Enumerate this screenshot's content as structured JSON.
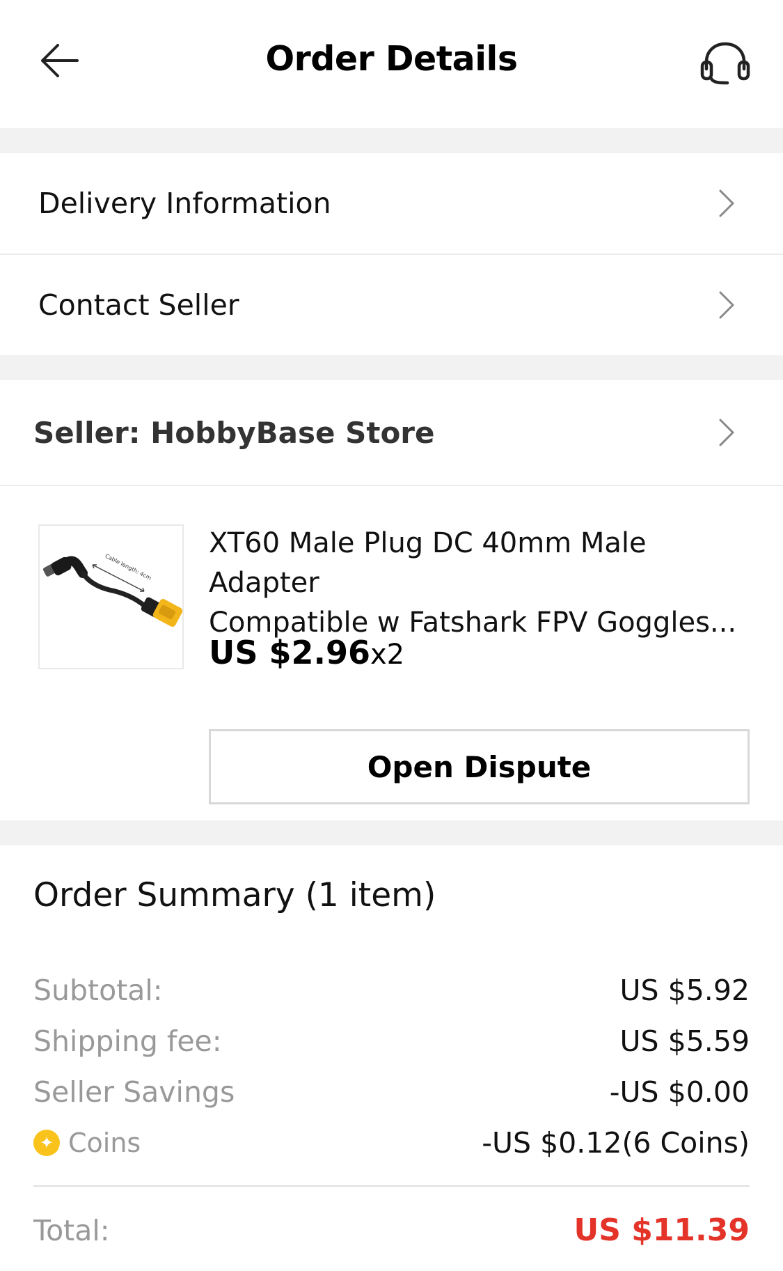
{
  "header": {
    "title": "Order Details",
    "back_icon": "arrow-left-icon",
    "support_icon": "headset-icon"
  },
  "menu": {
    "delivery_label": "Delivery Information",
    "contact_label": "Contact Seller"
  },
  "seller": {
    "label": "Seller: HobbyBase Store"
  },
  "product": {
    "title_line1": "XT60 Male Plug DC 40mm Male Adapter",
    "title_line2": "Compatible w Fatshark FPV Goggles...",
    "price": "US $2.96",
    "quantity": "x2",
    "image_caption": "Cable length: 4cm",
    "dispute_label": "Open Dispute"
  },
  "summary": {
    "title": "Order Summary (1 item)",
    "subtotal_label": "Subtotal:",
    "subtotal_value": "US $5.92",
    "shipping_label": "Shipping fee:",
    "shipping_value": "US $5.59",
    "savings_label": "Seller Savings",
    "savings_value": "-US $0.00",
    "coins_label": "Coins",
    "coins_value": "-US $0.12(6 Coins)",
    "total_label": "Total:",
    "total_value": "US $11.39"
  },
  "colors": {
    "accent_red": "#e4342a",
    "coin_yellow": "#f9c31b",
    "section_gap": "#f2f2f2"
  }
}
